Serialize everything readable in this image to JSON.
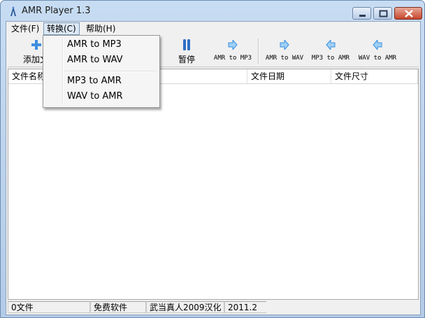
{
  "window": {
    "title": "AMR Player 1.3"
  },
  "menubar": {
    "file": "文件(F)",
    "convert": "转换(C)",
    "help": "帮助(H)"
  },
  "toolbar": {
    "add": "添加文",
    "pause": "暂停",
    "amr_to_mp3": "AMR to MP3",
    "amr_to_wav": "AMR to WAV",
    "mp3_to_amr": "MP3 to AMR",
    "wav_to_amr": "WAV to AMR"
  },
  "list": {
    "columns": {
      "name": "文件名称",
      "date": "文件日期",
      "size": "文件尺寸"
    }
  },
  "statusbar": {
    "count": "0文件",
    "license": "免费软件",
    "credit": "武当真人2009汉化",
    "version": "2011.2"
  },
  "convert_menu": {
    "items": [
      "AMR to MP3",
      "AMR to WAV",
      "MP3 to AMR",
      "WAV to AMR"
    ]
  },
  "colors": {
    "accent": "#3c8fe0",
    "pause_icon": "#2f6fc6"
  }
}
